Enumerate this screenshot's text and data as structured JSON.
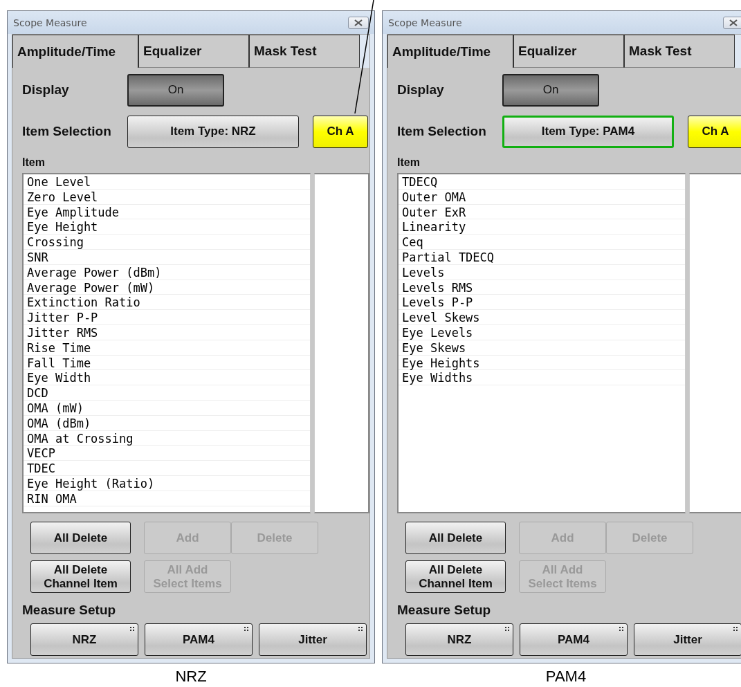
{
  "panels": [
    {
      "title": "Scope Measure",
      "tabs": [
        {
          "label": "Amplitude/Time",
          "selected": true
        },
        {
          "label": "Equalizer",
          "selected": false
        },
        {
          "label": "Mask Test",
          "selected": false
        }
      ],
      "display": {
        "label": "Display",
        "button": "On",
        "on": true
      },
      "item_selection": {
        "label": "Item Selection",
        "type_button": "Item Type: NRZ",
        "highlighted": false,
        "channel_button": "Ch A",
        "channel_active": true
      },
      "item_label": "Item",
      "items": [
        "One Level",
        "Zero Level",
        "Eye Amplitude",
        "Eye Height",
        "Crossing",
        "SNR",
        "Average Power (dBm)",
        "Average Power (mW)",
        "Extinction Ratio",
        "Jitter P-P",
        "Jitter RMS",
        "Rise Time",
        "Fall Time",
        "Eye Width",
        "DCD",
        "OMA (mW)",
        "OMA (dBm)",
        "OMA at Crossing",
        "VECP",
        "TDEC",
        "Eye Height (Ratio)",
        "RIN OMA"
      ],
      "actions": [
        {
          "label": "All Delete",
          "disabled": false
        },
        {
          "label": "Add",
          "disabled": true
        },
        {
          "label": "Delete",
          "disabled": true
        },
        {
          "label": "All Delete\nChannel Item",
          "disabled": false
        },
        {
          "label": "All Add\nSelect Items",
          "disabled": true
        }
      ],
      "measure_setup": {
        "label": "Measure Setup",
        "buttons": [
          "NRZ",
          "PAM4",
          "Jitter"
        ]
      },
      "caption": "NRZ"
    },
    {
      "title": "Scope Measure",
      "tabs": [
        {
          "label": "Amplitude/Time",
          "selected": true
        },
        {
          "label": "Equalizer",
          "selected": false
        },
        {
          "label": "Mask Test",
          "selected": false
        }
      ],
      "display": {
        "label": "Display",
        "button": "On",
        "on": true
      },
      "item_selection": {
        "label": "Item Selection",
        "type_button": "Item Type: PAM4",
        "highlighted": true,
        "channel_button": "Ch A",
        "channel_active": true
      },
      "item_label": "Item",
      "items": [
        "TDECQ",
        "Outer OMA",
        "Outer ExR",
        "Linearity",
        "Ceq",
        "Partial TDECQ",
        "Levels",
        "Levels RMS",
        "Levels P-P",
        "Level Skews",
        "Eye Levels",
        "Eye Skews",
        "Eye Heights",
        "Eye Widths"
      ],
      "actions": [
        {
          "label": "All Delete",
          "disabled": false
        },
        {
          "label": "Add",
          "disabled": true
        },
        {
          "label": "Delete",
          "disabled": true
        },
        {
          "label": "All Delete\nChannel Item",
          "disabled": false
        },
        {
          "label": "All Add\nSelect Items",
          "disabled": true
        }
      ],
      "measure_setup": {
        "label": "Measure Setup",
        "buttons": [
          "NRZ",
          "PAM4",
          "Jitter"
        ]
      },
      "caption": "PAM4"
    }
  ]
}
